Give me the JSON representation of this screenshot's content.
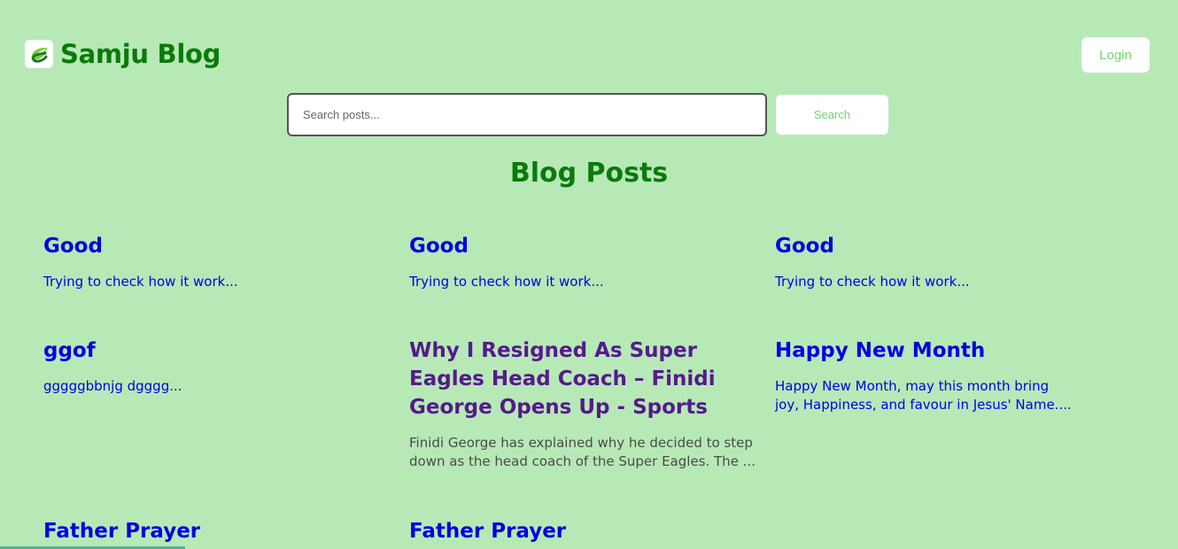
{
  "header": {
    "brand": "Samju Blog",
    "login_label": "Login"
  },
  "search": {
    "placeholder": "Search posts...",
    "button_label": "Search"
  },
  "main": {
    "title": "Blog Posts",
    "posts": [
      {
        "title": "Good",
        "excerpt": "Trying to check how it work..."
      },
      {
        "title": "Good",
        "excerpt": "Trying to check how it work..."
      },
      {
        "title": "Good",
        "excerpt": "Trying to check how it work..."
      },
      {
        "title": "ggof",
        "excerpt": "gggggbbnjg dgggg..."
      },
      {
        "title": "Why I Resigned As Super Eagles Head Coach – Finidi George Opens Up - Sports",
        "excerpt": "Finidi George has explained why he decided to step down as the head coach of the Super Eagles. The ..."
      },
      {
        "title": "Happy New Month",
        "excerpt": "Happy New Month, may this month bring joy, Happiness, and favour in Jesus' Name...."
      },
      {
        "title": "Father Prayer",
        "excerpt": ""
      },
      {
        "title": "Father Prayer",
        "excerpt": ""
      }
    ]
  },
  "colors": {
    "background": "#b7e9b7",
    "brand": "#0a7a0a",
    "link": "#0000e0",
    "visited_link": "#551a8b",
    "button_text": "#6fd46f"
  }
}
